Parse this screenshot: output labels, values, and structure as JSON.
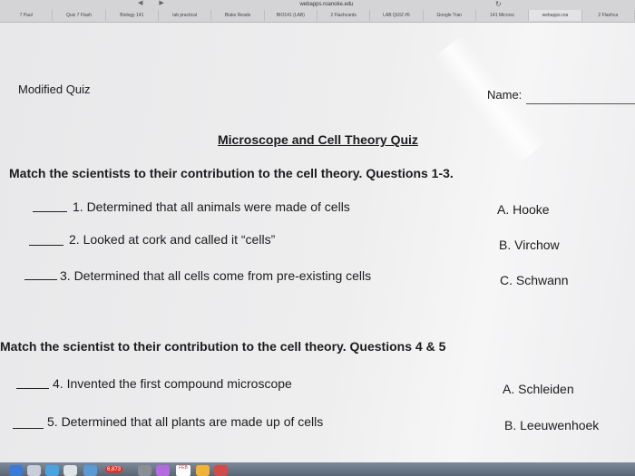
{
  "browser": {
    "address": "webapps.roanoke.edu",
    "reload_icon": "reload-icon",
    "tabs": [
      {
        "label": "7 Paul"
      },
      {
        "label": "Quiz 7 Flash"
      },
      {
        "label": "Biology 141"
      },
      {
        "label": "lab practical"
      },
      {
        "label": "Blake Reads"
      },
      {
        "label": "BIO141 (LAB)"
      },
      {
        "label": "2 Flashcards"
      },
      {
        "label": "LAB QUIZ #5"
      },
      {
        "label": "Google Tran"
      },
      {
        "label": "141 Microsc"
      },
      {
        "label": "webapps.roa"
      },
      {
        "label": "2 Flashca"
      }
    ]
  },
  "document": {
    "header_left": "Modified Quiz",
    "header_right": "Name:",
    "title": "Microscope and Cell Theory Quiz",
    "section1": {
      "instructions": "Match the scientists to their contribution to the cell theory. Questions 1-3.",
      "questions": [
        {
          "text": "1. Determined that all animals were made of cells"
        },
        {
          "text": "2. Looked at cork and called it “cells”"
        },
        {
          "text": "3. Determined that all cells come from pre-existing cells"
        }
      ],
      "answers": [
        {
          "text": "A. Hooke"
        },
        {
          "text": "B. Virchow"
        },
        {
          "text": "C. Schwann"
        }
      ]
    },
    "section2": {
      "instructions": "Match the scientist to their contribution to the cell theory. Questions 4 & 5",
      "questions": [
        {
          "text": "4. Invented the first compound microscope"
        },
        {
          "text": "5. Determined that all plants are made up of cells"
        }
      ],
      "answers": [
        {
          "text": "A. Schleiden"
        },
        {
          "text": "B. Leeuwenhoek"
        }
      ]
    }
  },
  "dock": {
    "mail_badge": "6,873",
    "calendar_month": "FEB"
  }
}
